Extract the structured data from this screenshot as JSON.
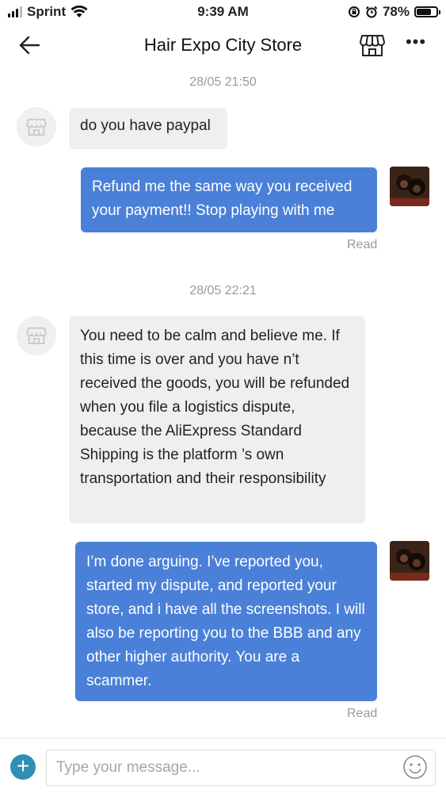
{
  "status_bar": {
    "carrier": "Sprint",
    "time": "9:39 AM",
    "battery_percent": "78%",
    "battery_level": 0.78,
    "icons": [
      "signal-icon",
      "wifi-icon",
      "lock-rotation-icon",
      "alarm-icon",
      "battery-icon"
    ]
  },
  "header": {
    "title": "Hair Expo City Store",
    "back_icon": "arrow-left-icon",
    "store_icon": "storefront-icon",
    "more_icon": "more-dots-icon",
    "more_label": "•••"
  },
  "conversation": {
    "timestamps": [
      "28/05 21:50",
      "28/05 22:21"
    ],
    "messages": [
      {
        "sender": "store",
        "text": "do you have paypal"
      },
      {
        "sender": "me",
        "text": "Refund me the same way you received your payment!! Stop playing with me",
        "status": "Read"
      },
      {
        "sender": "store",
        "text": "You need to be calm and believe me. If this time is over and you have n’t received the goods, you will be refunded  when you file a logistics dispute, because the AliExpress Standard Shipping is the platform ’s own transportation and their responsibility"
      },
      {
        "sender": "me",
        "text": "I’m done arguing. I’ve reported you, started my dispute, and reported your store, and i have all the screenshots. I will also be reporting you to the BBB and any other higher authority. You are a scammer.",
        "status": "Read"
      }
    ]
  },
  "composer": {
    "placeholder": "Type your message...",
    "value": "",
    "add_label": "+",
    "add_icon": "plus-icon",
    "emoji_icon": "smiley-icon"
  },
  "colors": {
    "outgoing_bubble": "#4a80d8",
    "incoming_bubble": "#efefef",
    "add_button": "#2e8fb4",
    "muted_text": "#9a9a9a"
  }
}
